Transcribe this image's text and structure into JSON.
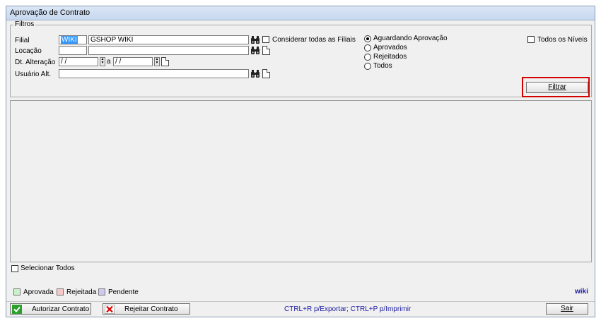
{
  "window": {
    "title": "Aprovação de Contrato"
  },
  "filters": {
    "group_label": "Filtros",
    "filial_label": "Filial",
    "filial_code": "WIKI",
    "filial_name": "GSHOP WIKI",
    "consider_all_label": "Considerar todas as Filiais",
    "locacao_label": "Locação",
    "locacao_code": "",
    "locacao_name": "",
    "dt_label": "Dt. Alteração",
    "dt_from": " / /",
    "dt_sep": "a",
    "dt_to": " / /",
    "usuario_label": "Usuário Alt.",
    "usuario_value": "",
    "status_options": [
      {
        "label": "Aguardando Aprovação",
        "selected": true
      },
      {
        "label": "Aprovados",
        "selected": false
      },
      {
        "label": "Rejeitados",
        "selected": false
      },
      {
        "label": "Todos",
        "selected": false
      }
    ],
    "todos_niveis_label": "Todos os Níveis",
    "filter_button": "Filtrar"
  },
  "select_all_label": "Selecionar Todos",
  "legend": [
    {
      "label": "Aprovada",
      "color": "#c9f2c9"
    },
    {
      "label": "Rejeitada",
      "color": "#f6c8c8"
    },
    {
      "label": "Pendente",
      "color": "#cfc8f0"
    }
  ],
  "brand": "wiki",
  "footer": {
    "authorize_button": "Autorizar Contrato",
    "reject_button": "Rejeitar Contrato",
    "shortcuts_text": "CTRL+R p/Exportar; CTRL+P p/Imprimir",
    "exit_button": "Sair"
  },
  "colors": {
    "accent_highlight": "#d40000",
    "shortcut_text": "#1a1aa0",
    "brand": "#1a1aa0"
  },
  "icons": [
    "binoculars-icon",
    "document-icon",
    "check-icon",
    "x-icon"
  ]
}
